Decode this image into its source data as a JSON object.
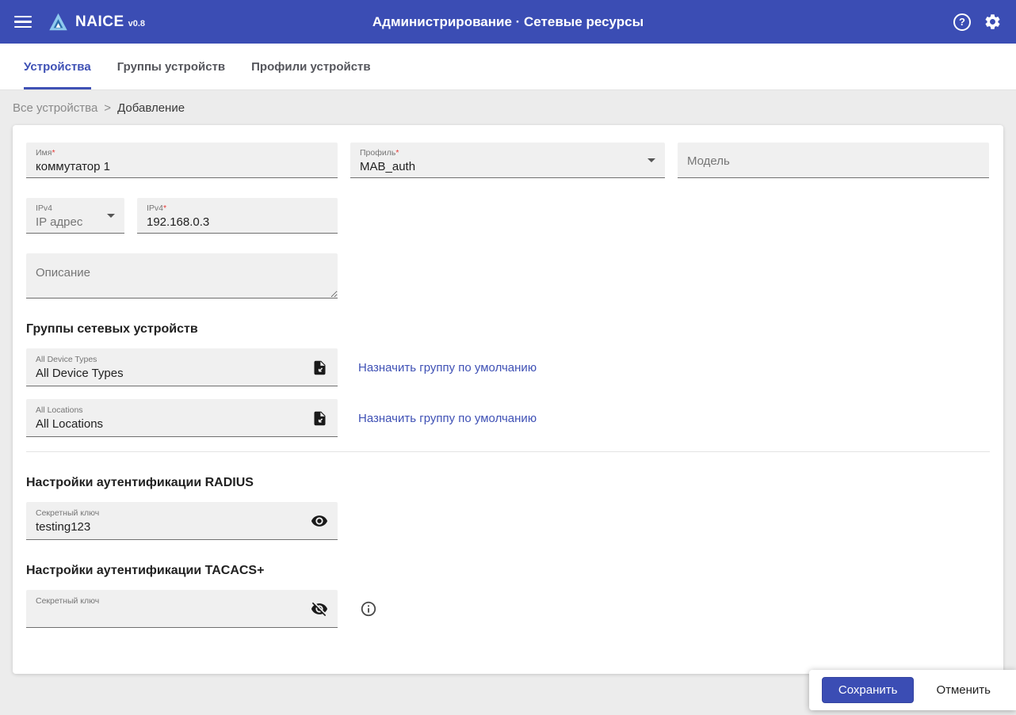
{
  "colors": {
    "primary": "#3b4db4",
    "link": "#3f51b5",
    "required": "#e53935"
  },
  "app_bar": {
    "brand": "NAICE",
    "version": "v0.8",
    "title": "Администрирование · Сетевые ресурсы",
    "help_glyph": "?"
  },
  "tabs": [
    {
      "label": "Устройства"
    },
    {
      "label": "Группы устройств"
    },
    {
      "label": "Профили устройств"
    }
  ],
  "breadcrumb": {
    "parent": "Все устройства",
    "separator": ">",
    "current": "Добавление"
  },
  "required_marker": "*",
  "form": {
    "name": {
      "label": "Имя",
      "value": "коммутатор 1"
    },
    "profile": {
      "label": "Профиль",
      "value": "MAB_auth"
    },
    "model": {
      "placeholder": "Модель"
    },
    "ip_type": {
      "label": "IPv4",
      "value": "IP адрес"
    },
    "ip_address": {
      "label": "IPv4",
      "value": "192.168.0.3"
    },
    "description": {
      "placeholder": "Описание"
    }
  },
  "groups_section": {
    "title": "Группы сетевых устройств",
    "items": [
      {
        "label": "All Device Types",
        "value": "All Device Types",
        "link": "Назначить группу по умолчанию"
      },
      {
        "label": "All Locations",
        "value": "All Locations",
        "link": "Назначить группу по умолчанию"
      }
    ]
  },
  "radius_section": {
    "title": "Настройки аутентификации RADIUS",
    "secret_label": "Секретный ключ",
    "secret_value": "testing123"
  },
  "tacacs_section": {
    "title": "Настройки аутентификации TACACS+",
    "secret_label": "Секретный ключ"
  },
  "actions": {
    "save": "Сохранить",
    "cancel": "Отменить"
  }
}
